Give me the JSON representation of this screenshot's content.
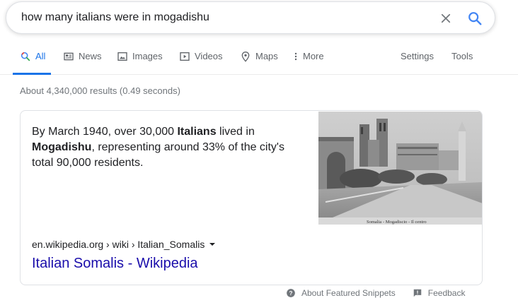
{
  "search": {
    "query": "how many italians were in mogadishu"
  },
  "tabs": [
    {
      "label": "All",
      "icon": "search-icon"
    },
    {
      "label": "News",
      "icon": "news-icon"
    },
    {
      "label": "Images",
      "icon": "image-icon"
    },
    {
      "label": "Videos",
      "icon": "video-icon"
    },
    {
      "label": "Maps",
      "icon": "map-pin-icon"
    },
    {
      "label": "More",
      "icon": "more-vert-icon"
    },
    {
      "label": "Settings"
    },
    {
      "label": "Tools"
    }
  ],
  "result_stats": "About 4,340,000 results (0.49 seconds)",
  "snippet": {
    "text_parts": [
      "By March 1940, over 30,000 ",
      "Italians",
      " lived in ",
      "Mogadishu",
      ", representing around 33% of the city's total 90,000 residents."
    ],
    "image_caption": "Somalia - Mogadiscio - Il centro",
    "cite": "en.wikipedia.org › wiki › Italian_Somalis",
    "title": "Italian Somalis - Wikipedia"
  },
  "footer": {
    "about": "About Featured Snippets",
    "feedback": "Feedback"
  },
  "colors": {
    "accent": "#1a73e8",
    "link": "#1a0dab",
    "muted": "#70757a"
  }
}
